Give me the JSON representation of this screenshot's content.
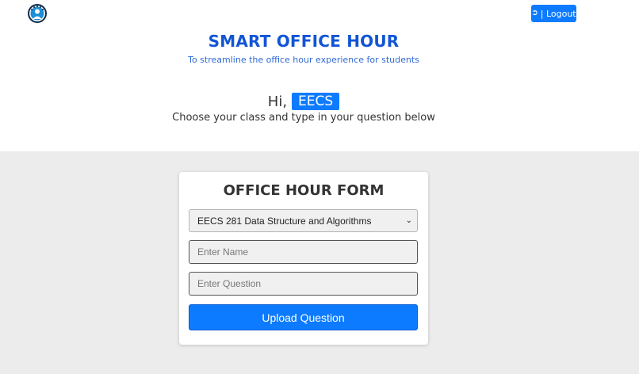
{
  "header": {
    "logo_icon": "speedometer-person-icon",
    "logout_icon": "sign-out-icon",
    "logout_label": "| Logout"
  },
  "hero": {
    "title": "SMART OFFICE HOUR",
    "subtitle": "To streamline the office hour experience for students",
    "greeting_prefix": "Hi,",
    "user_name": "EECS",
    "instruction": "Choose your class and type in your question below"
  },
  "form": {
    "title": "OFFICE HOUR FORM",
    "class_selected": "EECS 281 Data Structure and Algorithms",
    "name_placeholder": "Enter Name",
    "question_placeholder": "Enter Question",
    "submit_label": "Upload Question"
  },
  "colors": {
    "accent": "#0d7bff",
    "title_blue": "#1155d6",
    "background_gray": "#ececec"
  }
}
